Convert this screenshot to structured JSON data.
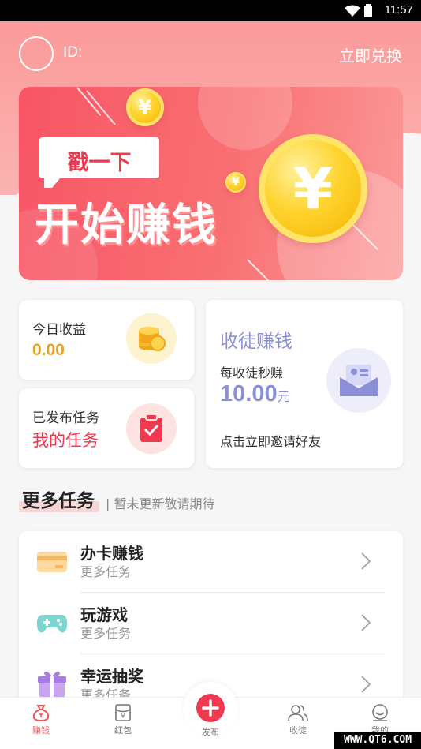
{
  "status_bar": {
    "time": "11:57"
  },
  "header": {
    "id_label": "ID:",
    "redeem_label": "立即兑换"
  },
  "banner": {
    "bubble_text": "戳一下",
    "title": "开始赚钱",
    "coin_symbol": "¥"
  },
  "today_card": {
    "label": "今日收益",
    "value": "0.00"
  },
  "tasks_card": {
    "label": "已发布任务",
    "link": "我的任务"
  },
  "invite_card": {
    "title": "收徒赚钱",
    "per_label": "每收徒秒赚",
    "amount": "10.00",
    "unit": "元",
    "cta": "点击立即邀请好友"
  },
  "more_tasks": {
    "title": "更多任务",
    "subtitle": "| 暂未更新敬请期待"
  },
  "task_list": [
    {
      "title": "办卡赚钱",
      "subtitle": "更多任务",
      "icon": "card-icon"
    },
    {
      "title": "玩游戏",
      "subtitle": "更多任务",
      "icon": "gamepad-icon"
    },
    {
      "title": "幸运抽奖",
      "subtitle": "更多任务",
      "icon": "gift-icon"
    }
  ],
  "tabbar": {
    "earn": "赚钱",
    "redpacket": "红包",
    "publish": "发布",
    "disciples": "收徒",
    "mine": "我的"
  },
  "watermark": "WWW.QT6.COM",
  "colors": {
    "accent": "#f0394f",
    "header_pink": "#fb9a9a",
    "gold": "#e3a521",
    "purple": "#8b8fd6"
  }
}
